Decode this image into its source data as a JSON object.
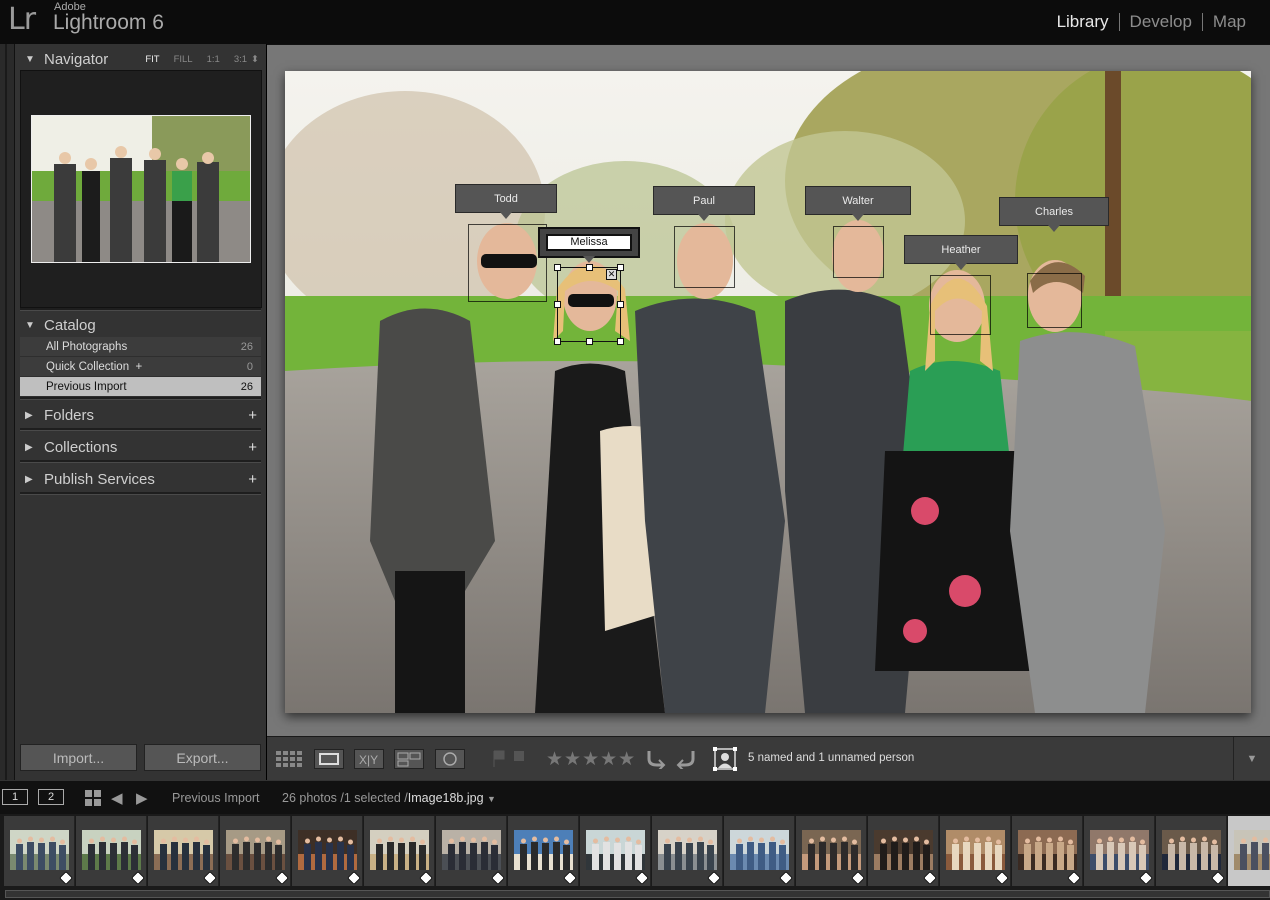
{
  "app": {
    "logo": "Lr",
    "vendor": "Adobe",
    "name": "Lightroom 6"
  },
  "modules": [
    "Library",
    "Develop",
    "Map"
  ],
  "active_module": "Library",
  "navigator": {
    "title": "Navigator",
    "zoom_options": [
      "FIT",
      "FILL",
      "1:1",
      "3:1"
    ],
    "active_zoom": "FIT"
  },
  "catalog": {
    "title": "Catalog",
    "items": [
      {
        "label": "All Photographs",
        "count": "26"
      },
      {
        "label": "Quick Collection  +",
        "count": "0"
      },
      {
        "label": "Previous Import",
        "count": "26"
      }
    ],
    "selected": "Previous Import"
  },
  "panels": [
    {
      "label": "Folders"
    },
    {
      "label": "Collections"
    },
    {
      "label": "Publish Services"
    }
  ],
  "buttons": {
    "import": "Import...",
    "export": "Export..."
  },
  "faces": [
    {
      "name": "Todd"
    },
    {
      "name": "Melissa"
    },
    {
      "name": "Paul"
    },
    {
      "name": "Walter"
    },
    {
      "name": "Heather"
    },
    {
      "name": "Charles"
    }
  ],
  "toolbar": {
    "face_count_text": "5 named and 1 unnamed person"
  },
  "filmstrip": {
    "monitor_1": "1",
    "monitor_2": "2",
    "source": "Previous Import",
    "count_text": "26 photos /1 selected /",
    "filename": "Image18b.jpg"
  }
}
